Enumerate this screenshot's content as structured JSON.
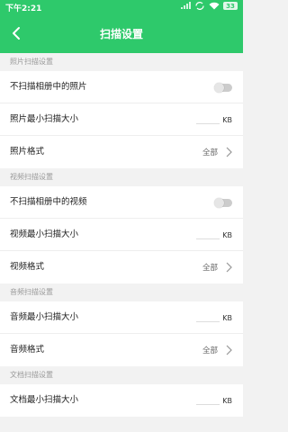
{
  "status_bar": {
    "time": "下午2:21",
    "battery": "33"
  },
  "header": {
    "title": "扫描设置"
  },
  "sections": [
    {
      "title": "照片扫描设置",
      "rows": [
        {
          "type": "toggle",
          "label": "不扫描相册中的照片",
          "on": false
        },
        {
          "type": "input",
          "label": "照片最小扫描大小",
          "unit": "KB"
        },
        {
          "type": "select",
          "label": "照片格式",
          "value": "全部"
        }
      ]
    },
    {
      "title": "视频扫描设置",
      "rows": [
        {
          "type": "toggle",
          "label": "不扫描相册中的视频",
          "on": false
        },
        {
          "type": "input",
          "label": "视频最小扫描大小",
          "unit": "KB"
        },
        {
          "type": "select",
          "label": "视频格式",
          "value": "全部"
        }
      ]
    },
    {
      "title": "音频扫描设置",
      "rows": [
        {
          "type": "input",
          "label": "音频最小扫描大小",
          "unit": "KB"
        },
        {
          "type": "select",
          "label": "音频格式",
          "value": "全部"
        }
      ]
    },
    {
      "title": "文档扫描设置",
      "rows": [
        {
          "type": "input",
          "label": "文档最小扫描大小",
          "unit": "KB"
        }
      ]
    }
  ],
  "colors": {
    "accent": "#2ec96b"
  }
}
